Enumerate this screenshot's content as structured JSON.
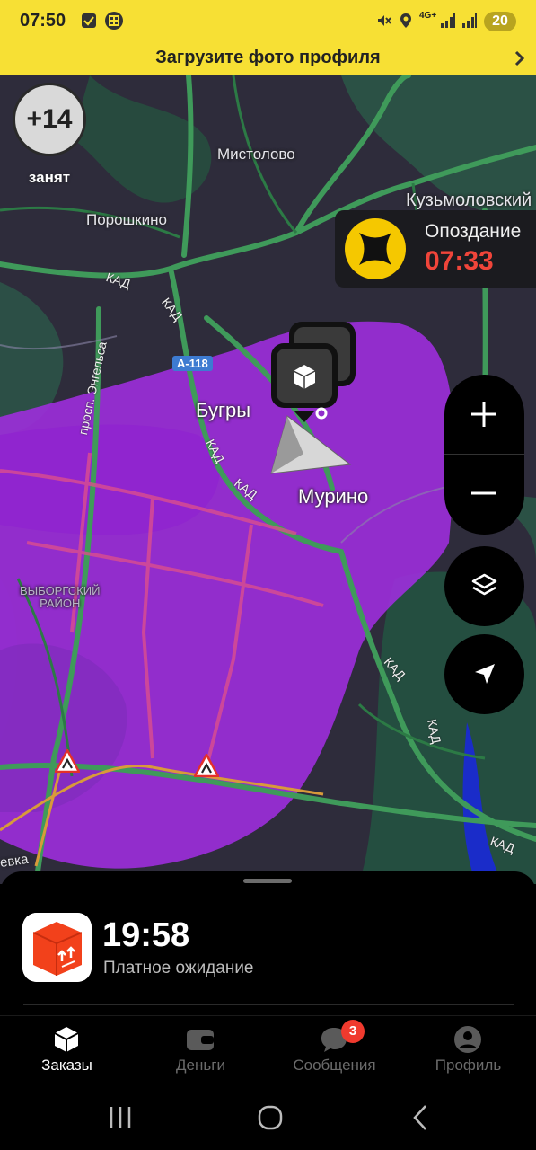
{
  "status_bar": {
    "time": "07:50",
    "battery": "20",
    "network": "4G+",
    "icons": [
      "checklist-icon",
      "app-notification-icon",
      "mute-icon",
      "location-icon",
      "signal-icon",
      "signal-icon",
      "battery-icon"
    ]
  },
  "banner": {
    "text": "Загрузите фото профиля"
  },
  "map": {
    "busy_counter": "+14",
    "busy_label": "занят",
    "places": {
      "mistolovo": "Мистолово",
      "kuzmolovsky": "Кузьмоловский",
      "poroshkino": "Порошкино",
      "bugry": "Бугры",
      "murino": "Мурино",
      "vyborgsky_line1": "ВЫБОРГСКИЙ",
      "vyborgsky_line2": "РАЙОН",
      "vka": "евка"
    },
    "roads": {
      "kad": "КАД",
      "engelsa": "просп. Энгельса",
      "a118": "А-118"
    },
    "late_card": {
      "title": "Опоздание",
      "time": "07:33"
    },
    "controls": [
      "zoom-in-icon",
      "zoom-out-icon",
      "layers-icon",
      "locate-icon"
    ],
    "colors": {
      "surge": "#a12ee0",
      "road": "#3f9a5a",
      "late": "#f0453a",
      "brand": "#f7e034"
    }
  },
  "sheet": {
    "time": "19:58",
    "subtitle": "Платное ожидание"
  },
  "tabs": [
    {
      "label": "Заказы",
      "active": true
    },
    {
      "label": "Деньги",
      "active": false
    },
    {
      "label": "Сообщения",
      "active": false,
      "badge": "3"
    },
    {
      "label": "Профиль",
      "active": false
    }
  ]
}
